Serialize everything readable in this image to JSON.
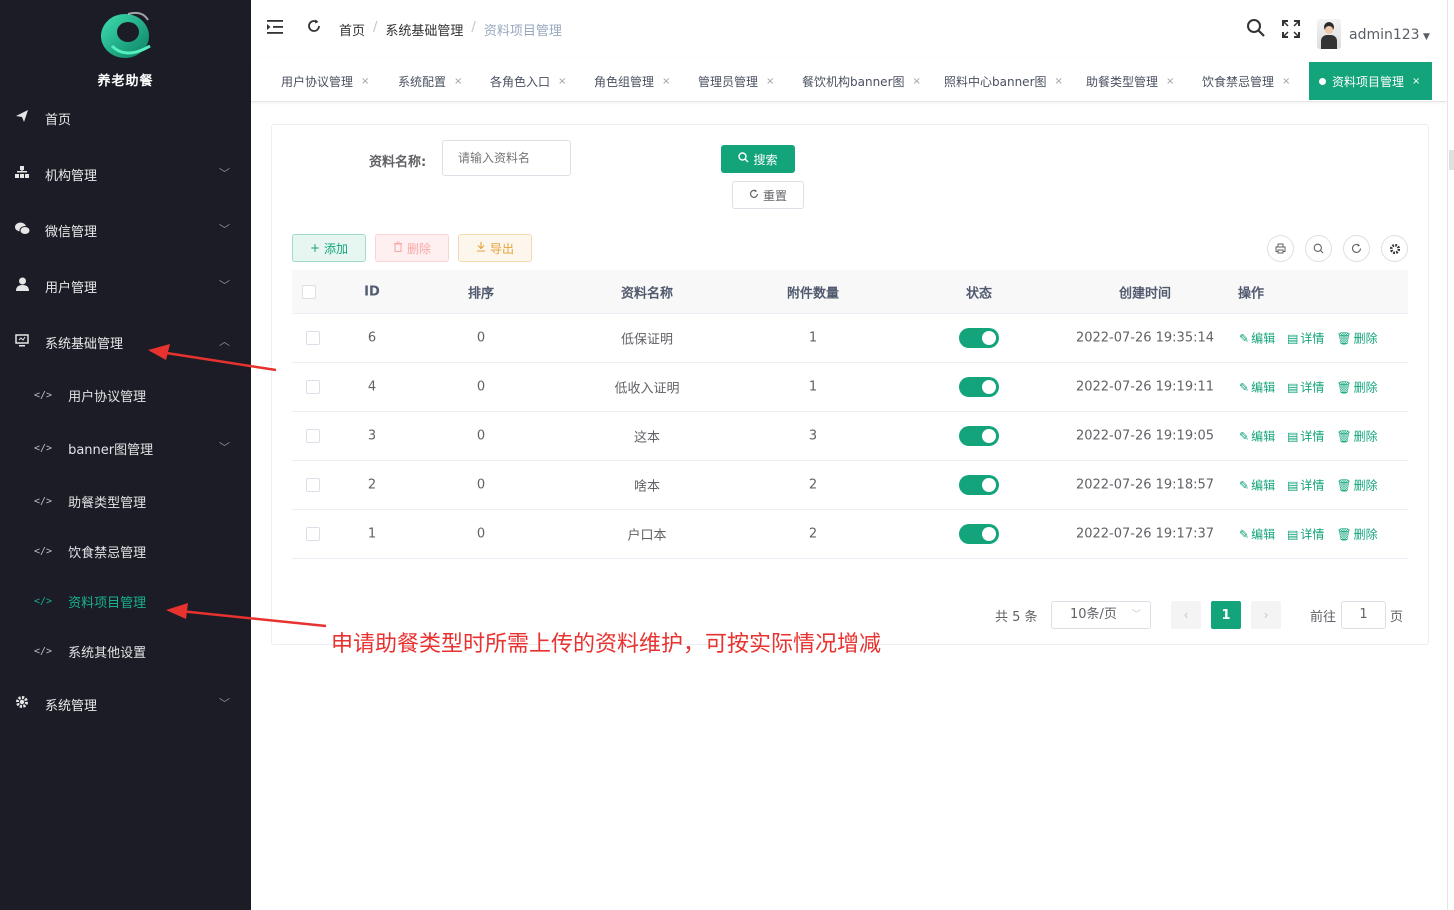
{
  "app": {
    "name": "养老助餐"
  },
  "sidebar": {
    "items": [
      {
        "label": "首页",
        "icon": "send-icon"
      },
      {
        "label": "机构管理",
        "icon": "sitemap-icon"
      },
      {
        "label": "微信管理",
        "icon": "wechat-icon"
      },
      {
        "label": "用户管理",
        "icon": "user-icon"
      },
      {
        "label": "系统基础管理",
        "icon": "monitor-icon"
      },
      {
        "label": "系统管理",
        "icon": "gear-icon"
      }
    ],
    "sub_items": [
      {
        "label": "用户协议管理"
      },
      {
        "label": "banner图管理"
      },
      {
        "label": "助餐类型管理"
      },
      {
        "label": "饮食禁忌管理"
      },
      {
        "label": "资料项目管理"
      },
      {
        "label": "系统其他设置"
      }
    ]
  },
  "header": {
    "breadcrumb": [
      "首页",
      "系统基础管理",
      "资料项目管理"
    ],
    "separator": "/",
    "username": "admin123"
  },
  "tabs": [
    {
      "label": "用户协议管理"
    },
    {
      "label": "系统配置"
    },
    {
      "label": "各角色入口"
    },
    {
      "label": "角色组管理"
    },
    {
      "label": "管理员管理"
    },
    {
      "label": "餐饮机构banner图"
    },
    {
      "label": "照料中心banner图"
    },
    {
      "label": "助餐类型管理"
    },
    {
      "label": "饮食禁忌管理"
    },
    {
      "label": "资料项目管理",
      "active": true
    }
  ],
  "tab_close": "×",
  "search": {
    "label": "资料名称:",
    "placeholder": "请输入资料名",
    "search_button": "搜索",
    "reset_button": "重置"
  },
  "toolbar": {
    "add": "添加",
    "delete": "删除",
    "export": "导出"
  },
  "table": {
    "columns": [
      "ID",
      "排序",
      "资料名称",
      "附件数量",
      "状态",
      "创建时间",
      "操作"
    ],
    "rows": [
      {
        "id": "6",
        "sort": "0",
        "name": "低保证明",
        "attachments": "1",
        "status": true,
        "created": "2022-07-26 19:35:14"
      },
      {
        "id": "4",
        "sort": "0",
        "name": "低收入证明",
        "attachments": "1",
        "status": true,
        "created": "2022-07-26 19:19:11"
      },
      {
        "id": "3",
        "sort": "0",
        "name": "这本",
        "attachments": "3",
        "status": true,
        "created": "2022-07-26 19:19:05"
      },
      {
        "id": "2",
        "sort": "0",
        "name": "啥本",
        "attachments": "2",
        "status": true,
        "created": "2022-07-26 19:18:57"
      },
      {
        "id": "1",
        "sort": "0",
        "name": "户口本",
        "attachments": "2",
        "status": true,
        "created": "2022-07-26 19:17:37"
      }
    ],
    "actions": {
      "edit": "编辑",
      "detail": "详情",
      "delete": "删除"
    }
  },
  "pagination": {
    "total": "共 5 条",
    "page_size": "10条/页",
    "current": "1",
    "goto_label": "前往",
    "goto_value": "1",
    "unit": "页"
  },
  "annotation": {
    "text": "申请助餐类型时所需上传的资料维护，可按实际情况增减"
  },
  "colors": {
    "sidebar_bg": "#1b1c26",
    "primary": "#13a47c",
    "annotation": "#e8322f"
  }
}
